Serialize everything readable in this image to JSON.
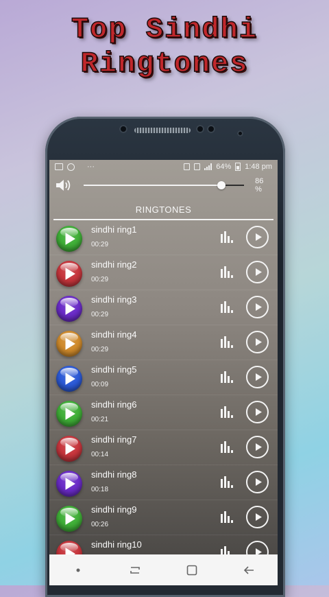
{
  "promo": {
    "title_line1": "Top Sindhi",
    "title_line2": "Ringtones"
  },
  "status_bar": {
    "dots": "···",
    "battery_percent": "64%",
    "time": "1:48 pm"
  },
  "volume": {
    "level": 0.86,
    "label": "86 %"
  },
  "tab": {
    "label": "RINGTONES"
  },
  "colors": {
    "green": "#3fae37",
    "red": "#c6353c",
    "purple": "#6a2bc7",
    "orange": "#cf8a2b",
    "blue": "#2b59d6"
  },
  "ringtones": [
    {
      "name": "sindhi ring1",
      "duration": "00:29",
      "color": "#3fae37"
    },
    {
      "name": "sindhi ring2",
      "duration": "00:29",
      "color": "#c6353c"
    },
    {
      "name": "sindhi ring3",
      "duration": "00:29",
      "color": "#6a2bc7"
    },
    {
      "name": "sindhi ring4",
      "duration": "00:29",
      "color": "#cf8a2b"
    },
    {
      "name": "sindhi ring5",
      "duration": "00:09",
      "color": "#2b59d6"
    },
    {
      "name": "sindhi ring6",
      "duration": "00:21",
      "color": "#3fae37"
    },
    {
      "name": "sindhi ring7",
      "duration": "00:14",
      "color": "#c6353c"
    },
    {
      "name": "sindhi ring8",
      "duration": "00:18",
      "color": "#6a2bc7"
    },
    {
      "name": "sindhi ring9",
      "duration": "00:26",
      "color": "#3fae37"
    },
    {
      "name": "sindhi ring10",
      "duration": "",
      "color": "#c6353c"
    }
  ],
  "icons": {
    "volume": "speaker-icon",
    "level": "equalizer-icon",
    "play": "play-icon",
    "nav_recent": "recent-apps-icon",
    "nav_home": "home-icon",
    "nav_back": "back-icon"
  }
}
